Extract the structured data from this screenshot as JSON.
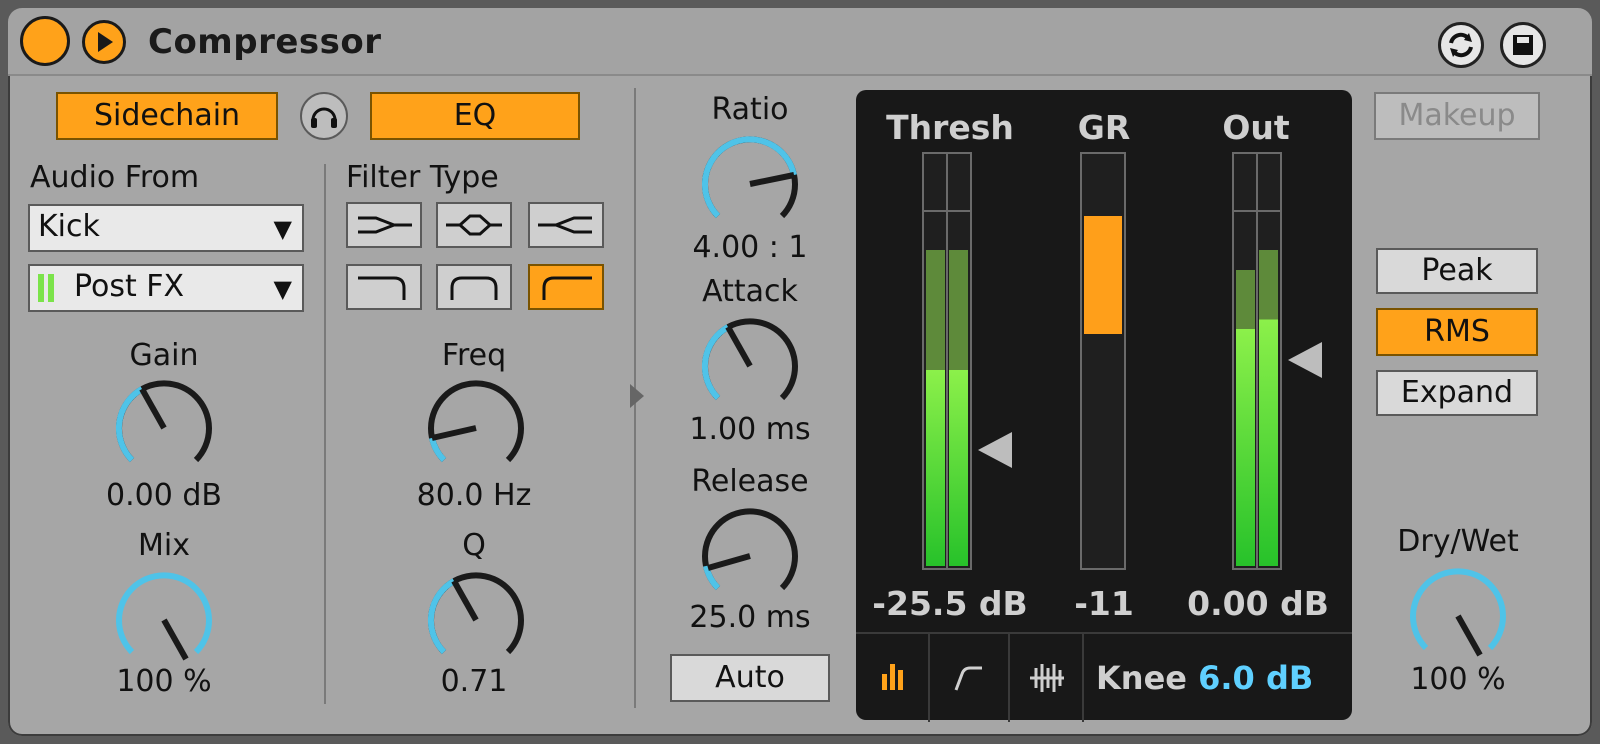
{
  "device": {
    "title": "Compressor"
  },
  "left": {
    "sidechain_label": "Sidechain",
    "eq_label": "EQ",
    "audio_from_label": "Audio From",
    "audio_from_value": "Kick",
    "tap_value": "Post FX",
    "gain": {
      "label": "Gain",
      "value": "0.00 dB"
    },
    "mix": {
      "label": "Mix",
      "value": "100 %"
    }
  },
  "filter": {
    "label": "Filter Type",
    "types": [
      "lowpass-split",
      "bandpass",
      "highpass-split",
      "lowpass",
      "bandpass-shelf",
      "highpass"
    ],
    "selected": "highpass",
    "freq": {
      "label": "Freq",
      "value": "80.0 Hz"
    },
    "q": {
      "label": "Q",
      "value": "0.71"
    }
  },
  "dynamics": {
    "ratio": {
      "label": "Ratio",
      "value": "4.00 : 1"
    },
    "attack": {
      "label": "Attack",
      "value": "1.00 ms"
    },
    "release": {
      "label": "Release",
      "value": "25.0 ms"
    },
    "auto_label": "Auto"
  },
  "display": {
    "thresh": {
      "label": "Thresh",
      "value": "-25.5 dB"
    },
    "gr": {
      "label": "GR",
      "value": "-11"
    },
    "out": {
      "label": "Out",
      "value": "0.00 dB"
    },
    "knee_label": "Knee",
    "knee_value": "6.0 dB"
  },
  "right": {
    "makeup_label": "Makeup",
    "peak_label": "Peak",
    "rms_label": "RMS",
    "expand_label": "Expand",
    "drywet": {
      "label": "Dry/Wet",
      "value": "100 %"
    }
  },
  "colors": {
    "accent": "#ffa21a",
    "knob_arc": "#4fc3e8",
    "meter_green": "#7be34a",
    "knee_value": "#5fd0ff"
  }
}
